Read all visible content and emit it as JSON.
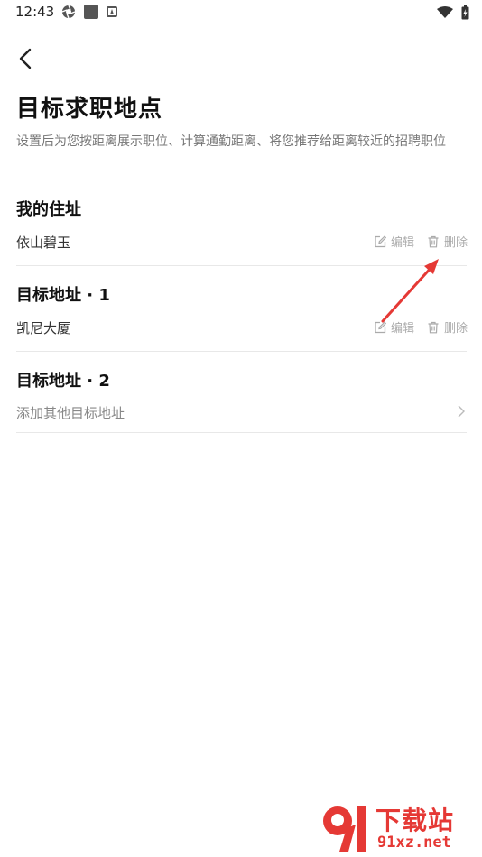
{
  "status_bar": {
    "time": "12:43"
  },
  "header": {
    "title": "目标求职地点",
    "description": "设置后为您按距离展示职位、计算通勤距离、将您推荐给距离较近的招聘职位"
  },
  "sections": [
    {
      "title": "我的住址",
      "address": "依山碧玉",
      "edit_label": "编辑",
      "delete_label": "删除"
    },
    {
      "title": "目标地址 · 1",
      "address": "凯尼大厦",
      "edit_label": "编辑",
      "delete_label": "删除"
    },
    {
      "title": "目标地址 · 2",
      "placeholder": "添加其他目标地址"
    }
  ],
  "watermark": {
    "title": "下载站",
    "subtitle": "91xz.net"
  },
  "colors": {
    "accent_red": "#e53935",
    "muted_text": "#aaaaaa",
    "divider": "#e8e8e8"
  }
}
